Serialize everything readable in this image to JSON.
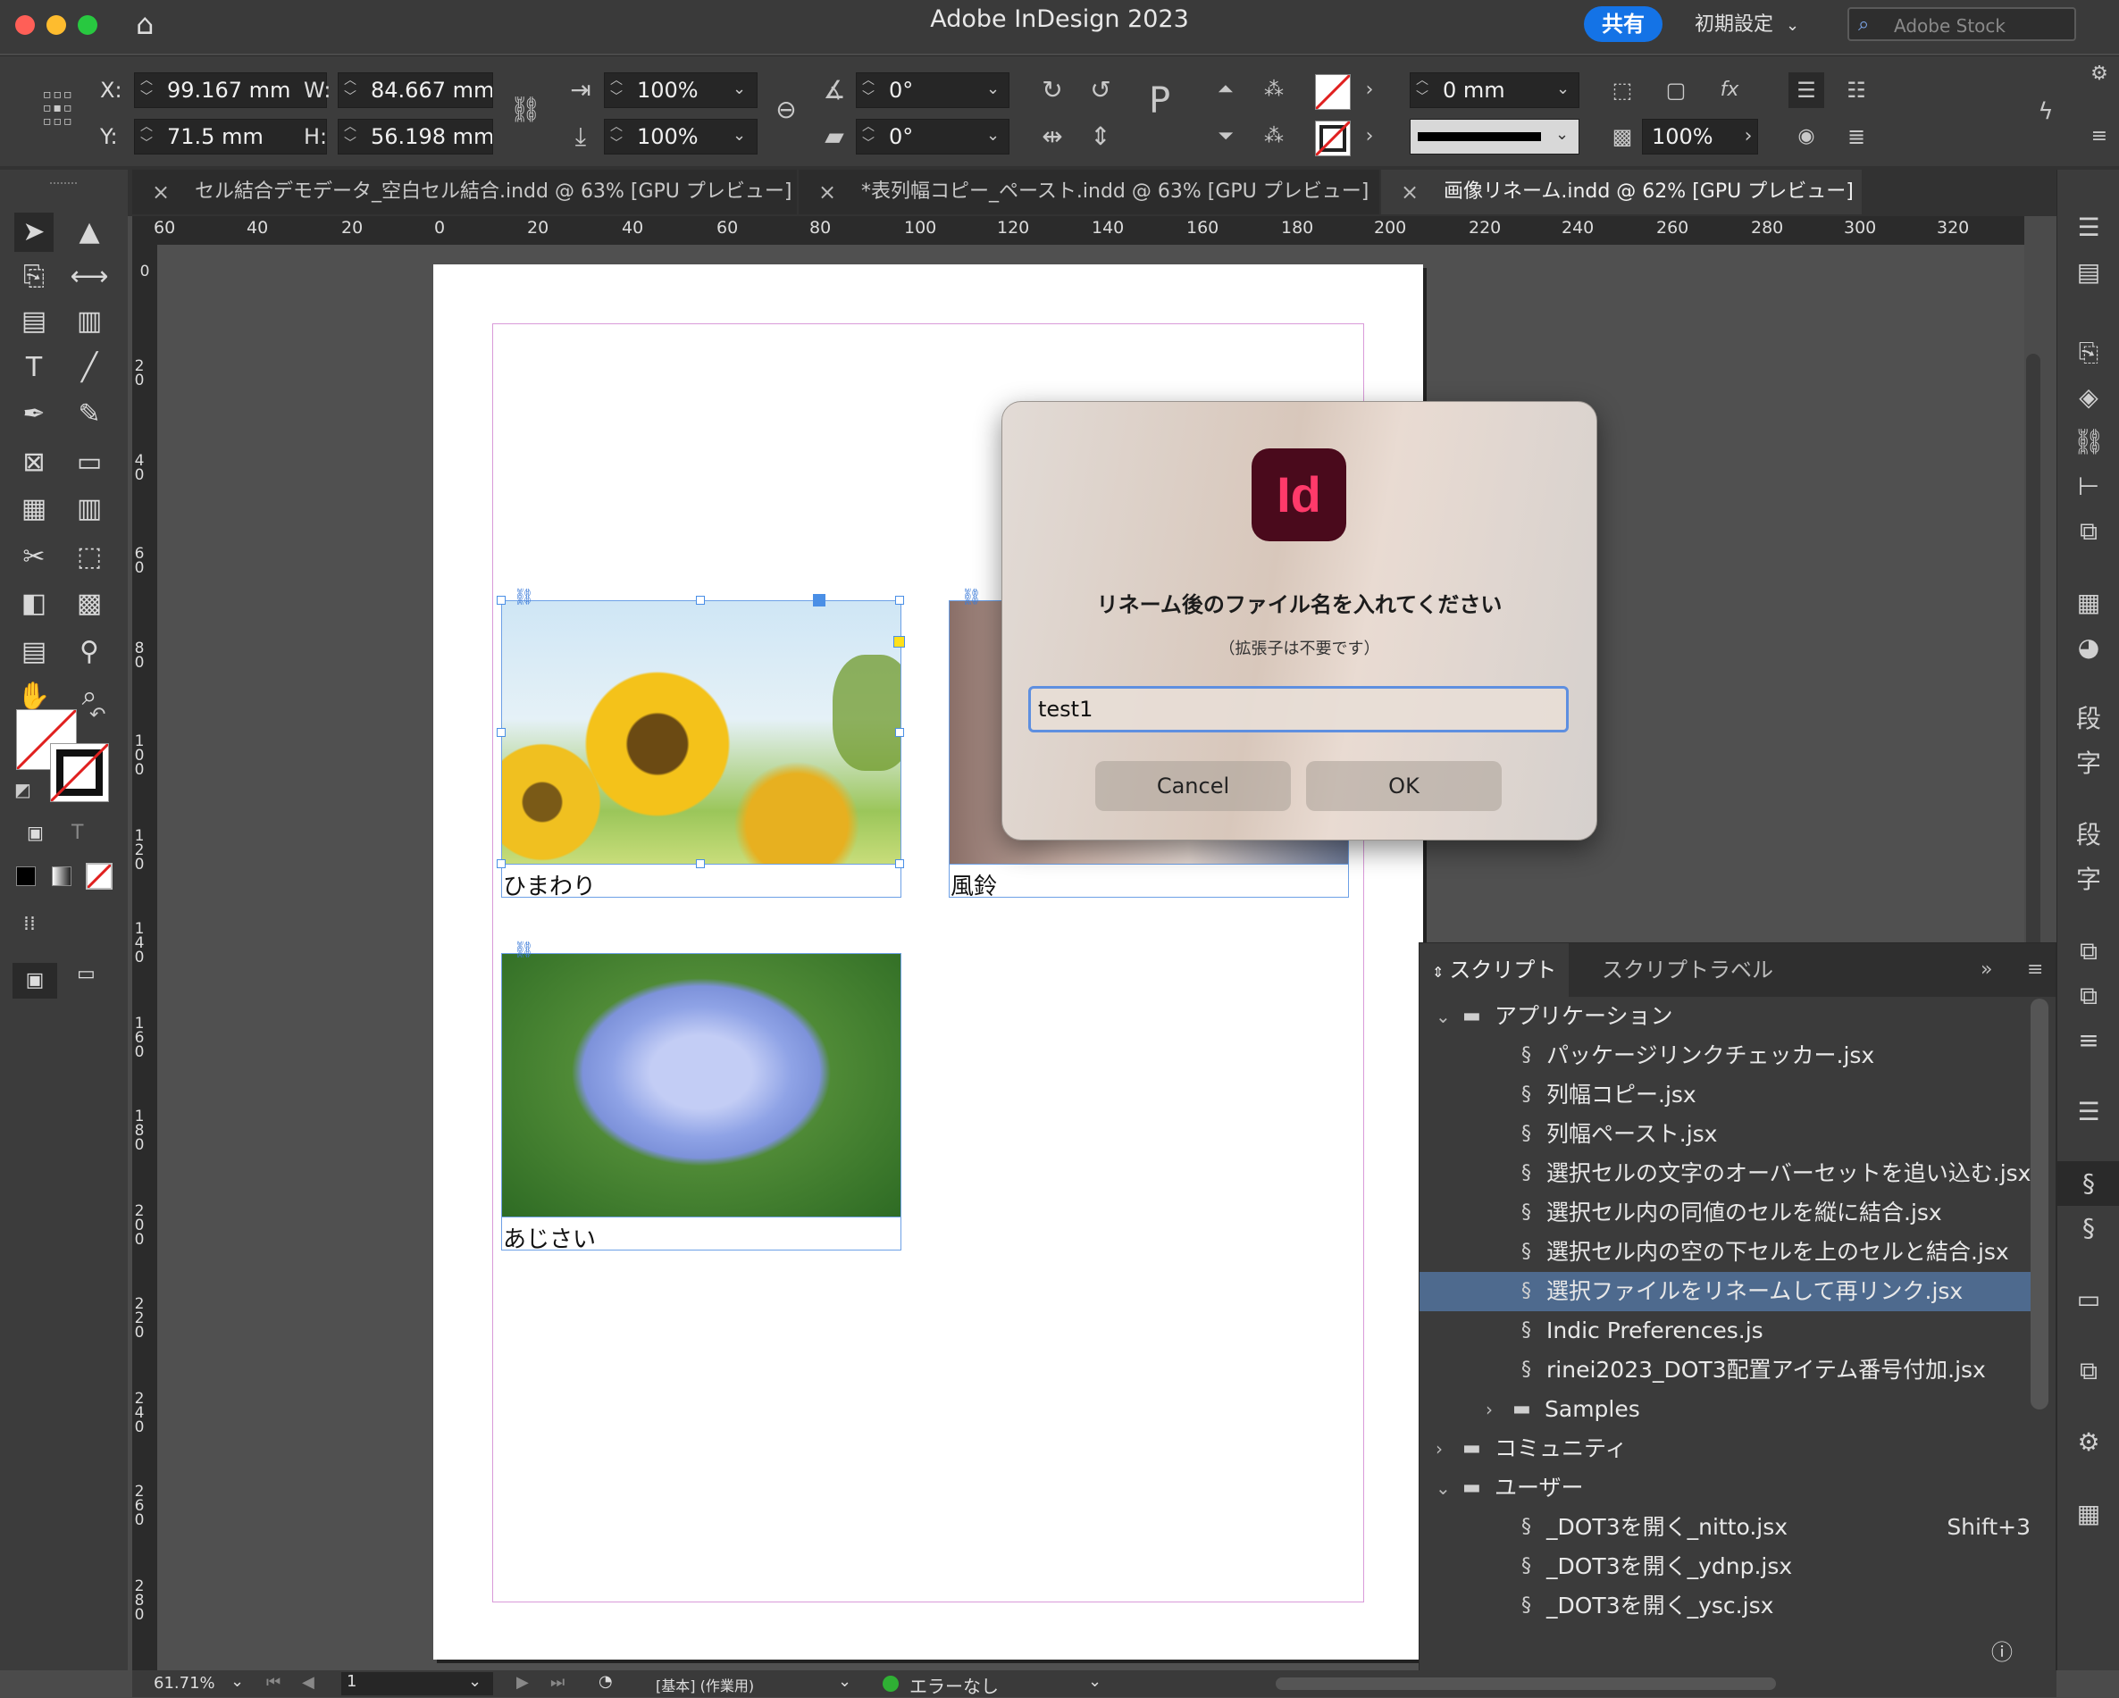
{
  "window": {
    "title": "Adobe InDesign 2023",
    "share_label": "共有",
    "workspace_label": "初期設定",
    "stock_placeholder": "Adobe Stock"
  },
  "control": {
    "x_label": "X:",
    "x_value": "99.167 mm",
    "y_label": "Y:",
    "y_value": "71.5 mm",
    "w_label": "W:",
    "w_value": "84.667 mm",
    "h_label": "H:",
    "h_value": "56.198 mm",
    "scale_x": "100%",
    "scale_y": "100%",
    "rotate": "0°",
    "shear": "0°",
    "stroke_weight": "0 mm",
    "opacity": "100%"
  },
  "tabs": [
    {
      "label": "セル結合デモデータ_空白セル結合.indd @ 63% [GPU プレビュー]"
    },
    {
      "label": "*表列幅コピー_ペースト.indd @ 63% [GPU プレビュー]"
    },
    {
      "label": "画像リネーム.indd @ 62% [GPU プレビュー]"
    }
  ],
  "ruler": {
    "h": [
      "60",
      "40",
      "20",
      "0",
      "20",
      "40",
      "60",
      "80",
      "100",
      "120",
      "140",
      "160",
      "180",
      "200",
      "220",
      "240",
      "260",
      "280",
      "300",
      "320"
    ],
    "v": [
      "0",
      "20",
      "40",
      "60",
      "80",
      "100",
      "120",
      "140",
      "160",
      "180",
      "200",
      "220",
      "240",
      "260",
      "280"
    ]
  },
  "page": {
    "captions": [
      "ひまわり",
      "風鈴",
      "あじさい"
    ]
  },
  "dialog": {
    "app_icon": "Id",
    "message": "リネーム後のファイル名を入れてください",
    "sub": "（拡張子は不要です）",
    "input_value": "test1",
    "cancel": "Cancel",
    "ok": "OK"
  },
  "scripts_panel": {
    "tab_scripts": "スクリプト",
    "tab_label": "スクリプトラベル",
    "rows": [
      {
        "label": "アプリケーション",
        "kind": "folder",
        "open": true,
        "indent": 0
      },
      {
        "label": "パッケージリンクチェッカー.jsx",
        "kind": "script",
        "indent": 1
      },
      {
        "label": "列幅コピー.jsx",
        "kind": "script",
        "indent": 1
      },
      {
        "label": "列幅ペースト.jsx",
        "kind": "script",
        "indent": 1
      },
      {
        "label": "選択セルの文字のオーバーセットを追い込む.jsx",
        "kind": "script",
        "indent": 1
      },
      {
        "label": "選択セル内の同値のセルを縦に結合.jsx",
        "kind": "script",
        "indent": 1
      },
      {
        "label": "選択セル内の空の下セルを上のセルと結合.jsx",
        "kind": "script",
        "indent": 1
      },
      {
        "label": "選択ファイルをリネームして再リンク.jsx",
        "kind": "script",
        "indent": 1,
        "selected": true
      },
      {
        "label": "Indic Preferences.js",
        "kind": "script",
        "indent": 1
      },
      {
        "label": "rinei2023_DOT3配置アイテム番号付加.jsx",
        "kind": "script",
        "indent": 1
      },
      {
        "label": "Samples",
        "kind": "folder",
        "open": false,
        "indent": 1
      },
      {
        "label": "コミュニティ",
        "kind": "folder",
        "open": false,
        "indent": 0
      },
      {
        "label": "ユーザー",
        "kind": "folder",
        "open": true,
        "indent": 0
      },
      {
        "label": "_DOT3を開く_nitto.jsx",
        "kind": "script",
        "indent": 1,
        "shortcut": "Shift+3"
      },
      {
        "label": "_DOT3を開く_ydnp.jsx",
        "kind": "script",
        "indent": 1
      },
      {
        "label": "_DOT3を開く_ysc.jsx",
        "kind": "script",
        "indent": 1
      }
    ]
  },
  "status": {
    "zoom": "61.71%",
    "page": "1",
    "style": "[基本] (作業用)",
    "preflight": "エラーなし"
  },
  "colors": {
    "accent": "#1473e6",
    "selected_row": "#4e6a8e",
    "margin_guide": "#d99ad9"
  }
}
